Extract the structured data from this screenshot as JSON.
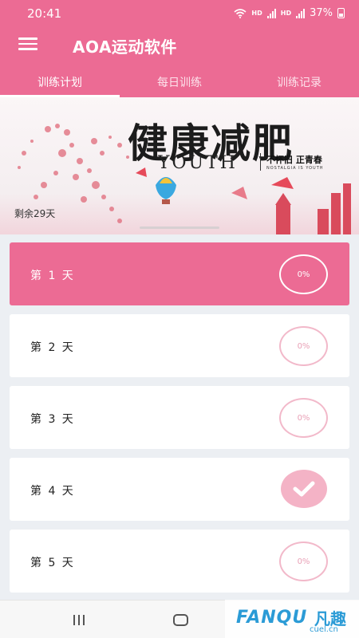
{
  "status_bar": {
    "time": "20:41",
    "hd1": "HD",
    "hd2": "HD",
    "battery_percent": "37%"
  },
  "app_bar": {
    "title": "AOA运动软件",
    "menu_icon": "hamburger-menu-icon"
  },
  "tabs": [
    {
      "label": "训练计划",
      "active": true
    },
    {
      "label": "每日训练",
      "active": false
    },
    {
      "label": "训练记录",
      "active": false
    }
  ],
  "banner": {
    "title": "健康减肥",
    "youth": "YOUTH",
    "tag": "不怀旧 正青春",
    "sub": "NOSTALGIA IS YOUTH",
    "remaining": "剩余29天"
  },
  "days": [
    {
      "label": "第 1 天",
      "progress": "0%",
      "completed": false,
      "active": true
    },
    {
      "label": "第 2 天",
      "progress": "0%",
      "completed": false,
      "active": false
    },
    {
      "label": "第 3 天",
      "progress": "0%",
      "completed": false,
      "active": false
    },
    {
      "label": "第 4 天",
      "progress": "",
      "completed": true,
      "active": false
    },
    {
      "label": "第 5 天",
      "progress": "0%",
      "completed": false,
      "active": false
    }
  ],
  "watermark": {
    "brand": "FANQU",
    "brand_cn": "凡趣",
    "url": "cuel.cn"
  },
  "colors": {
    "primary": "#ec6b94",
    "ring": "#f2b9ca",
    "check": "#f4b3c6",
    "background": "#eceff3"
  }
}
